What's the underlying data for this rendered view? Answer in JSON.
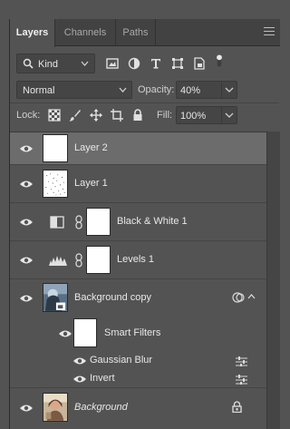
{
  "tabs": [
    {
      "label": "Layers",
      "active": true
    },
    {
      "label": "Channels",
      "active": false
    },
    {
      "label": "Paths",
      "active": false
    }
  ],
  "filter": {
    "kind_label": "Kind"
  },
  "blend": {
    "mode": "Normal",
    "opacity_label": "Opacity:",
    "opacity_value": "40%"
  },
  "lock": {
    "label": "Lock:",
    "fill_label": "Fill:",
    "fill_value": "100%"
  },
  "layers": [
    {
      "name": "Layer 2",
      "selected": true
    },
    {
      "name": "Layer 1"
    },
    {
      "name": "Black & White 1"
    },
    {
      "name": "Levels 1"
    },
    {
      "name": "Background copy"
    },
    {
      "name": "Smart Filters"
    },
    {
      "name": "Gaussian Blur"
    },
    {
      "name": "Invert"
    },
    {
      "name": "Background"
    }
  ],
  "colors": {
    "panel": "#535353",
    "selected": "#6c6c6c",
    "tabbar": "#424242",
    "field": "#454545"
  }
}
